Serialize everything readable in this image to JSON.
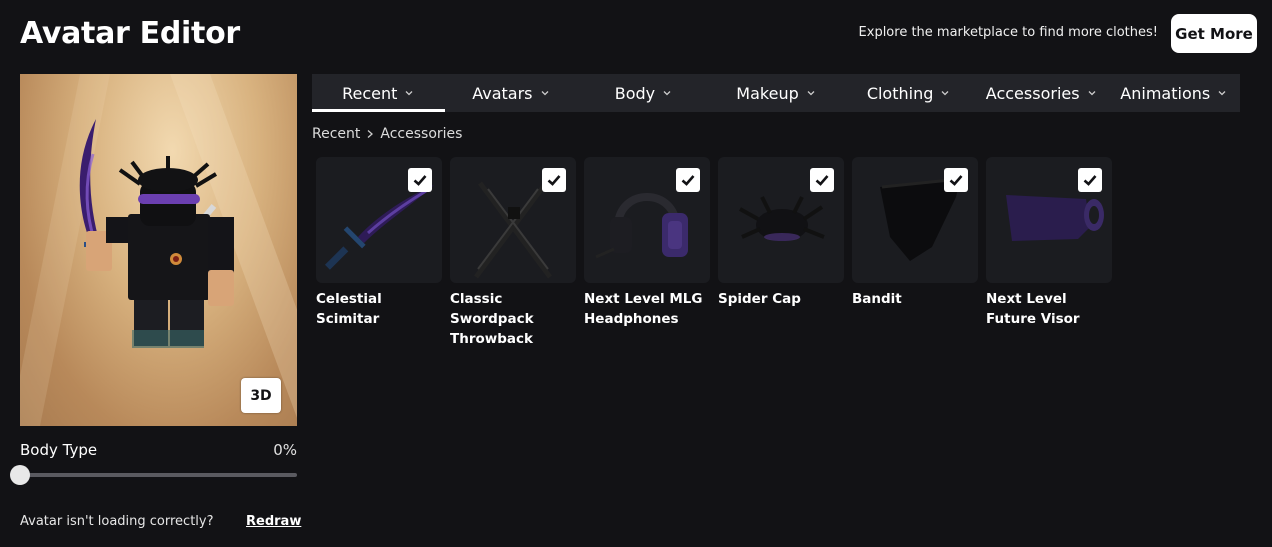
{
  "header": {
    "title": "Avatar Editor",
    "promo_text": "Explore the marketplace to find more clothes!",
    "get_more_label": "Get More"
  },
  "preview": {
    "button_3d": "3D",
    "body_type_label": "Body Type",
    "body_type_value": "0%",
    "body_type_fraction": 0,
    "loading_question": "Avatar isn't loading correctly?",
    "redraw_label": "Redraw"
  },
  "tabs": [
    {
      "label": "Recent",
      "active": true
    },
    {
      "label": "Avatars",
      "active": false
    },
    {
      "label": "Body",
      "active": false
    },
    {
      "label": "Makeup",
      "active": false
    },
    {
      "label": "Clothing",
      "active": false
    },
    {
      "label": "Accessories",
      "active": false
    },
    {
      "label": "Animations",
      "active": false
    }
  ],
  "breadcrumb": [
    "Recent",
    "Accessories"
  ],
  "items": [
    {
      "name": "Celestial Scimitar",
      "checked": true,
      "icon": "scimitar-icon"
    },
    {
      "name": "Classic Swordpack Throwback",
      "checked": true,
      "icon": "swordpack-icon"
    },
    {
      "name": "Next Level MLG Headphones",
      "checked": true,
      "icon": "headphones-icon"
    },
    {
      "name": "Spider Cap",
      "checked": true,
      "icon": "spider-cap-icon"
    },
    {
      "name": "Bandit",
      "checked": true,
      "icon": "bandit-icon"
    },
    {
      "name": "Next Level Future Visor",
      "checked": true,
      "icon": "visor-icon"
    }
  ],
  "colors": {
    "background": "#121215",
    "tab_bar": "#232429",
    "card": "#1b1c20"
  }
}
